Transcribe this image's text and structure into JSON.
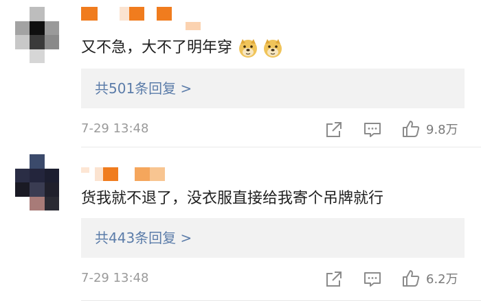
{
  "comments": [
    {
      "text": "又不急，大不了明年穿",
      "emojis": [
        "doge-emoji",
        "doge-emoji"
      ],
      "replies_label": "共501条回复 >",
      "timestamp": "7-29 13:48",
      "likes": "9.8万"
    },
    {
      "text": "货我就不退了，没衣服直接给我寄个吊牌就行",
      "emojis": [],
      "replies_label": "共443条回复 >",
      "timestamp": "7-29 13:48",
      "likes": "6.2万"
    }
  ],
  "icons": {
    "share": "share-icon",
    "comment": "comment-icon",
    "like": "thumbs-up-icon"
  },
  "colors": {
    "reply_link": "#5b7ca9",
    "reply_bg": "#f2f2f2",
    "meta_text": "#9a9a9a",
    "username_mosaic": "#f07c1e"
  }
}
